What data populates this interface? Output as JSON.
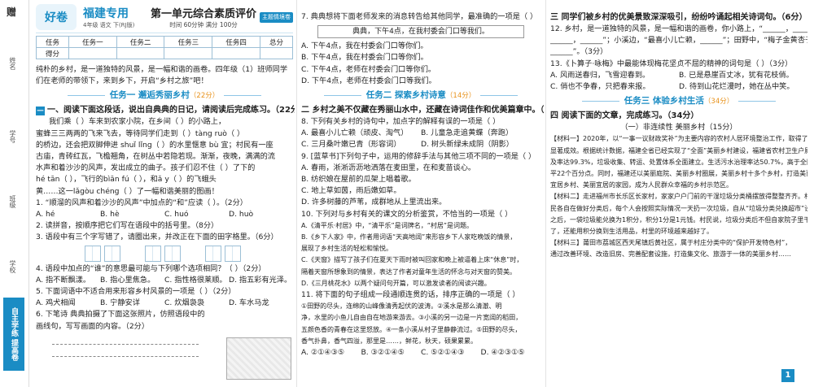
{
  "spine": {
    "logo_text": "赠",
    "fields": [
      "姓名",
      "学号",
      "班级",
      "学校"
    ],
    "brand_text": "自主学练 提高卷"
  },
  "header": {
    "logo": "好卷",
    "province": "福建专用",
    "meta": "4年级 语文 下(RJ版)",
    "title": "第一单元综合素质评价",
    "sub": "时间 60分钟 满分 100分",
    "badge": "主题情境卷"
  },
  "score_table": {
    "row1": [
      "任务",
      "任务一",
      "任务二",
      "任务三",
      "任务四",
      "总分"
    ],
    "row2": [
      "得分",
      "",
      "",
      "",
      "",
      ""
    ]
  },
  "col1": {
    "intro": [
      "纯朴的乡村，是一道独特的风景，是一幅和谐的画卷。四年级（1）班师同学",
      "们在老师的带领下，来到乡下，开启“乡村之旅”吧！"
    ],
    "task1": {
      "title": "任务一  邂逅秀丽乡村",
      "pts": "（22分）"
    },
    "q_hdr": "一、阅读下面这段话，说出自典典的日记，请阅读后完成练习。（22分）",
    "passage": [
      "我们乘（    ）车来到农家小院，在乡间（    ）的小路上，",
      "蜜蜂三三两两的飞来飞去，等待同学们走到（    ）tàng ruò（    ）",
      "的桥边，还会把双脚伸进 shuǐ lǐng（    ）的水里惬意 bù 宜；村民有一座",
      "古庙，青砖红瓦，飞檐翘角，在树丛中若隐若现。渐渐，夜晚，满满的流",
      "水声和着沙沙的风声，发出成立的曲子。孩子们忍不住（    ）了下的",
      "hé tān（    ），飞行的bìān fú（    ），和ǎ y（    ）的飞蛾头",
      "黄……这一lǎgòu chéng（    ）了一幅和谐美丽的图画！"
    ],
    "q1": "1. “顺溜的风声和着沙沙的风声”中加点的“和”应读（   ）。（2分）",
    "q1_opts": [
      "A. hé",
      "B. hè",
      "C. huó",
      "D. huò"
    ],
    "q2": "2. 读拼音，按顺序把它们写在语段中的括号里。（8分）",
    "q3": "3. 语段中有三个字写错了，请圈出来，并改正在下面的田字格里。（6分）",
    "q4": "4. 语段中加点的“谁”的意思最可能与下列哪个选项相同？（   ）（2分）",
    "q4_opts": [
      "A. 指不断飘漾。",
      "B. 指心里焦急。",
      "C. 指性格很莱顺。",
      "D. 指五彩有光泽。"
    ],
    "q5": "5. 下面词语中不适合用来形容乡村风景的一项是（   ）（2分）",
    "q5_opts": [
      "A. 鸡犬相闻",
      "B. 宁静安详",
      "C. 炊烟袅袅",
      "D. 车水马龙"
    ],
    "q6": "6. 下笔诗  典典拍摄了下面这张照片，仿照语段中的",
    "q6b": "   画线句，写写画面的内容。（2分）"
  },
  "col2": {
    "q7": "7. 典典想将下面老师发来的消息转告给其他同学，最准确的一项是（   ）",
    "q7_box": "典典，下午4点，在我村委会门口等我们。",
    "q7_opts": [
      "A. 下午4点，我在村委会门口等你们。",
      "B. 下午4点，我在村委会门口等你们。",
      "C. 下午4点，老师在村委会门口等你们。",
      "D. 下午4点，老师在村委会门口等我们。"
    ],
    "task2": {
      "title": "任务二  探索乡村诗意",
      "pts": "（14分）"
    },
    "sec": "二 乡村之美不仅藏在秀丽山水中，还藏在诗词佳作和优美篇章中。（8分）",
    "q8": "8. 下列有关乡村的诗句中，加点字的解释有误的一项是（   ）",
    "q8_opts": [
      "A. 最喜小儿亡赖（顽皮、淘气）",
      "B. 儿童急走追黄蝶（奔跑）",
      "C. 三月桑叶嫩已青（形容词）",
      "D. 树头新绿未成阴（阴影）"
    ],
    "q9": "9. [蓝草书]下列句子中，运用的修辞手法与其他三项不同的一项是（   ）",
    "q9_opts": [
      "A. 春雨，淅淅沥沥地洒落在麦田里，在和麦苗谈心。",
      "B. 纺织娘在屋前的瓜架上唱着歌。",
      "C. 地上草如茵，雨后嫩如草。",
      "D. 许多树藤的芦苇，成群地从上里流出来。"
    ],
    "q10": "10. 下列对与乡村有关的课文的分析鉴赏，不恰当的一项是（   ）",
    "q10_opts": [
      "A.《清平乐·村居》中，“清平乐”是词牌名，“村居”是词题。",
      "B.《乡下人家》中，作者用词语“天高地阔”来形容乡下人家吃晚饭的情景，",
      "   展现了乡村生活的轻松和愉悦。",
      "C.《天窗》描写了孩子们在夏天下雨时被叫回家和晚上被逼着上床“休息”时，",
      "   隔着天窗所想象到的情景，表达了作者对童年生活的怀念与对天窗的赞美。",
      "D.《三月桃花水》以两个疑问句开篇，可以激发读者的阅读兴趣。"
    ],
    "q11": "11. 将下面的句子组成一段通顺连贯的话，排序正确的一项是（   ）",
    "q11_text": [
      "①田野的尽头，连绵的山峰像清秀起伏的波涛。②溪水是那么清澈、明",
      "净，水里的小鱼儿自由自在地游来游去。③小溪的另一边是一片宽阔的稻田，",
      "五颜色香的青春在这里怒放。④一条小溪从村子里静静流过。⑤田野的尽头，",
      "香气扑鼻，香气四溢，那里是……，鲜花，秋天，硕果累累。"
    ],
    "q11_opts": [
      "A. ②①④③⑤",
      "B. ③②①④⑤",
      "C. ⑤②①④③",
      "D. ④②③①⑤"
    ]
  },
  "col3": {
    "sec3": "三 同学们被乡村的优美景致深深吸引，纷纷吟诵起相关诗词句。（6分）",
    "q12": "12. 乡村，是一道独特的风景，是一幅和谐的画卷，你小路上，“______，______",
    "q12b": "______，______”；小溪边，“最喜小儿亡赖，______”；田野中，“梅子金黄杏子肥，",
    "q12c": "______”。（3分）",
    "q13": "13.《卜算子·咏梅》中最能体现梅花坚贞不屈的精神的词句是（   ）（3分）",
    "q13_opts": [
      "A. 风雨送春归，飞雪迎春到。",
      "B. 已是悬崖百丈冰，犹有花枝俏。",
      "C. 俏也不争春，只把春来报。",
      "D. 待到山花烂漫时，她在丛中笑。"
    ],
    "task3": {
      "title": "任务三  体验乡村生活",
      "pts": "（34分）"
    },
    "sec4": "四 阅读下面的文章，完成练习。（34分）",
    "reading_title": "（一）非连续性  美丽乡村（15分）",
    "paras": [
      "【材料一】2020年，以“一事一议财政奖补”为主要内容的农村人居环境整治工作，取得了",
      "显著成效。根据统计数据，福建全省已经实现了“全面”美丽乡村建设，福建省农村卫生户厕普",
      "及率达99.3%，垃圾收集、转运、处置体系全面建立。生活污水治理率达50.7%，高于全国平均水",
      "平22个百分点。同时，福建还以美丽庭院、美丽乡村圈展，美丽乡村十多个乡村，打造美丽",
      "宜居乡村、美丽宜居的家园，成为人民群众幸福的乡村示范区。",
      "【材料二】走进福州市长乐区长家村，家家户户门前的干湿垃圾分类桶摆放得整整齐齐。村",
      "民各自在做好分类后，每个人会按照实际情况一天扔一次垃圾，自从“垃圾分类兑换超市”设立",
      "之后，一袋垃圾能兑换为1积分，积分1分是1元钱。村民说，垃圾分类后不但自家院子里干净",
      "了，还能用积分换到生活用品，村里的环境越来越好了。",
      "【材料三】莆田市荔城区西天尾镇后黄社区，属于村庄分类中的“保护开发特色村”，",
      "通过改善环境、改造旧房、完善配套设施，打造集文化、旅游于一体的美丽乡村……"
    ],
    "page_no": "1"
  }
}
